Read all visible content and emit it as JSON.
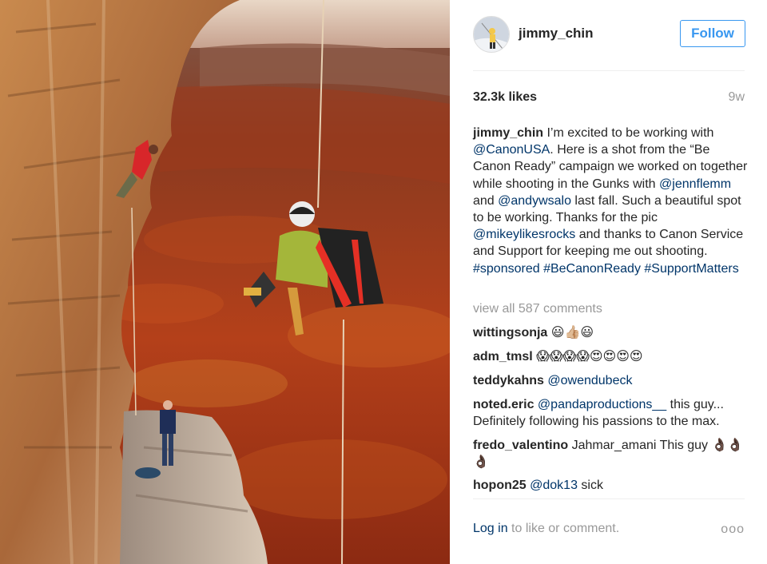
{
  "header": {
    "username": "jimmy_chin",
    "follow_label": "Follow"
  },
  "meta": {
    "likes": "32.3k likes",
    "time_ago": "9w"
  },
  "caption": {
    "username": "jimmy_chin",
    "t1": " I’m excited to be working with ",
    "m1": "@CanonUSA",
    "t2": ". Here is a shot from the “Be Canon Ready” campaign we worked on together while shooting in the Gunks with ",
    "m2": "@jennflemm",
    "t3": " and ",
    "m3": "@andywsalo",
    "t4": " last fall. Such a beautiful spot to be working. Thanks for the pic ",
    "m4": "@mikeylikesrocks",
    "t5": " and thanks to Canon Service and Support for keeping me out shooting. ",
    "h1": "#sponsored",
    "t6": " ",
    "h2": "#BeCanonReady",
    "t7": " ",
    "h3": "#SupportMatters"
  },
  "view_all": "view all 587 comments",
  "comments": [
    {
      "user": "wittingsonja",
      "text": " 😃👍🏼😃"
    },
    {
      "user": "adm_tmsl",
      "text": " 😱😱😱😱😍😍😍😍"
    },
    {
      "user": "teddykahns",
      "mention": "@owendubeck",
      "text": ""
    },
    {
      "user": "noted.eric",
      "mention": "@pandaproductions__",
      "text": " this guy... Definitely following his passions to the max."
    },
    {
      "user": "fredo_valentino",
      "text": " Jahmar_amani This guy 👌🏿👌🏿👌🏿"
    },
    {
      "user": "hopon25",
      "mention": "@dok13",
      "text": " sick"
    }
  ],
  "footer": {
    "login_link": "Log in",
    "login_rest": " to like or comment.",
    "more_label": "ooo"
  },
  "colors": {
    "link": "#003569",
    "follow_blue": "#3897f0",
    "muted": "#999999"
  },
  "icons": {
    "avatar": "avatar-photo"
  }
}
